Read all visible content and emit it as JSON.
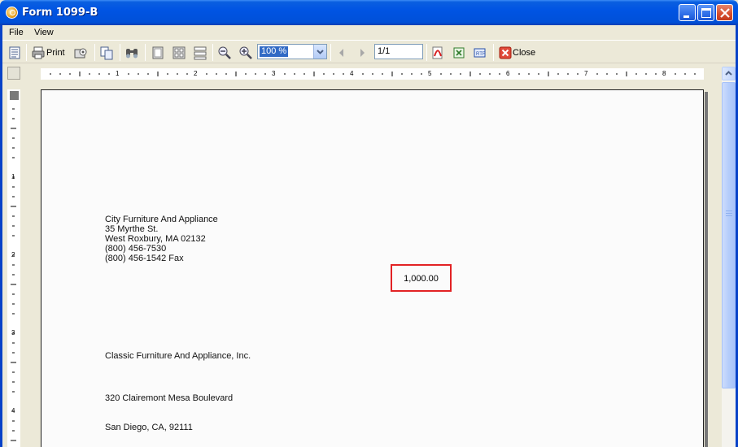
{
  "window": {
    "title": "Form 1099-B"
  },
  "menu": {
    "items": [
      "File",
      "View"
    ]
  },
  "toolbar": {
    "print_label": "Print",
    "zoom_value": "100 %",
    "page_value": "1/1",
    "close_label": "Close"
  },
  "ruler": {
    "horizontal_labels": [
      "1",
      "2",
      "3",
      "4",
      "5",
      "6",
      "7",
      "8"
    ],
    "vertical_labels": [
      "1",
      "2",
      "3",
      "4"
    ]
  },
  "document": {
    "payer": {
      "name": "City Furniture And Appliance",
      "street": "35 Myrthe St.",
      "city_state_zip": "West Roxbury,  MA  02132",
      "phone": "(800) 456-7530",
      "fax": "(800) 456-1542 Fax"
    },
    "amount": "1,000.00",
    "recipient": {
      "name": "Classic Furniture And Appliance, Inc.",
      "street": "320 Clairemont Mesa Boulevard",
      "city_state_zip": "San Diego, CA, 92111"
    }
  },
  "colors": {
    "title_bar": "#0054e3",
    "highlight_box": "#e22224",
    "window_bg": "#ece9d8"
  }
}
